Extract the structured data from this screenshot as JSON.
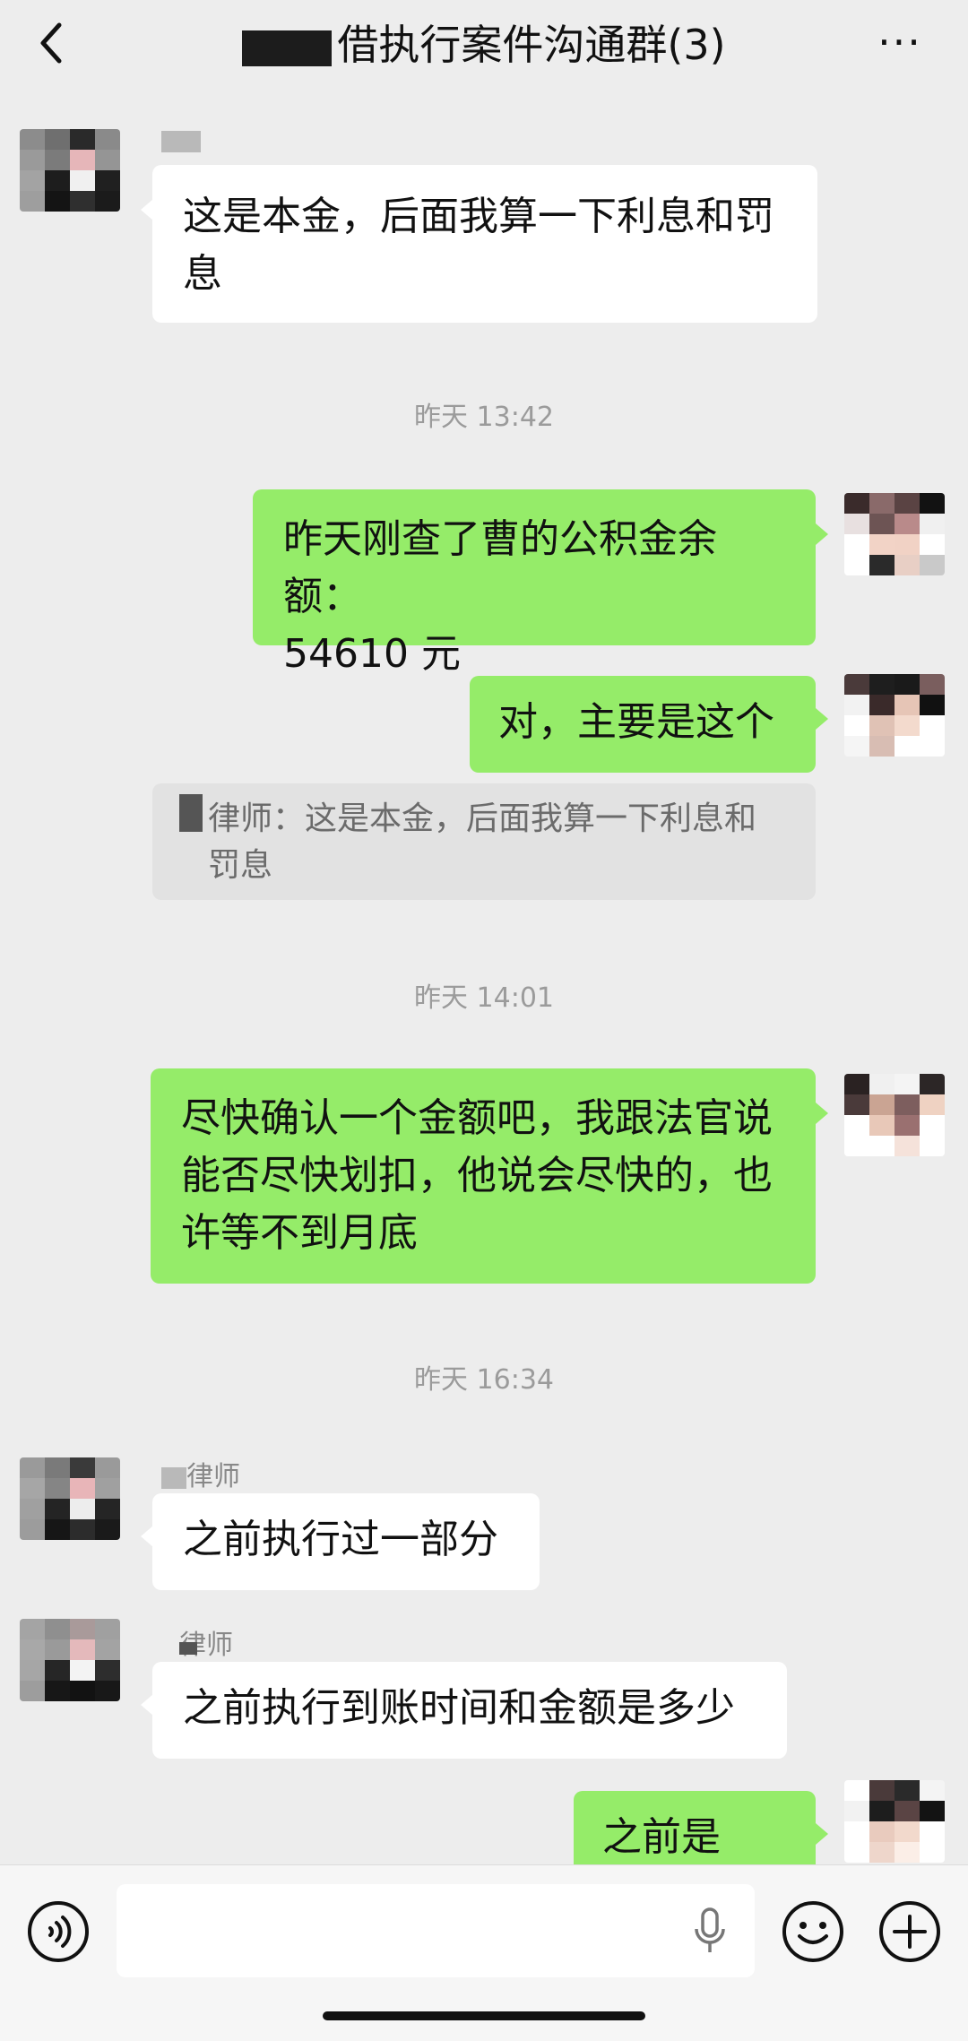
{
  "header": {
    "title": "▆▆▆▆借执行案件沟通群(3)",
    "title_visible": "借执行案件沟通群(3)",
    "more_label": "···"
  },
  "messages": [
    {
      "side": "left",
      "text": "这是本金，后面我算一下利息和罚\n息"
    },
    {
      "timestamp": "昨天 13:42"
    },
    {
      "side": "right",
      "text": "昨天刚查了曹的公积金余额：\n54610 元"
    },
    {
      "side": "right",
      "text": "对，主要是这个",
      "quote": "律师：这是本金，后面我算一下利息和\n罚息"
    },
    {
      "timestamp": "昨天 14:01"
    },
    {
      "side": "right",
      "text": "尽快确认一个金额吧，我跟法官说\n能否尽快划扣，他说会尽快的，也\n许等不到月底"
    },
    {
      "timestamp": "昨天 16:34"
    },
    {
      "side": "left",
      "sender": "律师",
      "text": "之前执行过一部分"
    },
    {
      "side": "left",
      "sender": "律师",
      "text": "之前执行到账时间和金额是多少"
    },
    {
      "side": "right",
      "text": "之前是指？"
    }
  ],
  "icons": {
    "back": "chevron-left-icon",
    "more": "more-icon",
    "voice": "voice-icon",
    "mic": "microphone-icon",
    "emoji": "emoji-icon",
    "plus": "plus-icon"
  },
  "colors": {
    "background": "#ededed",
    "green_bubble": "#95ec69",
    "white_bubble": "#ffffff",
    "timestamp": "#9b9b9b"
  }
}
